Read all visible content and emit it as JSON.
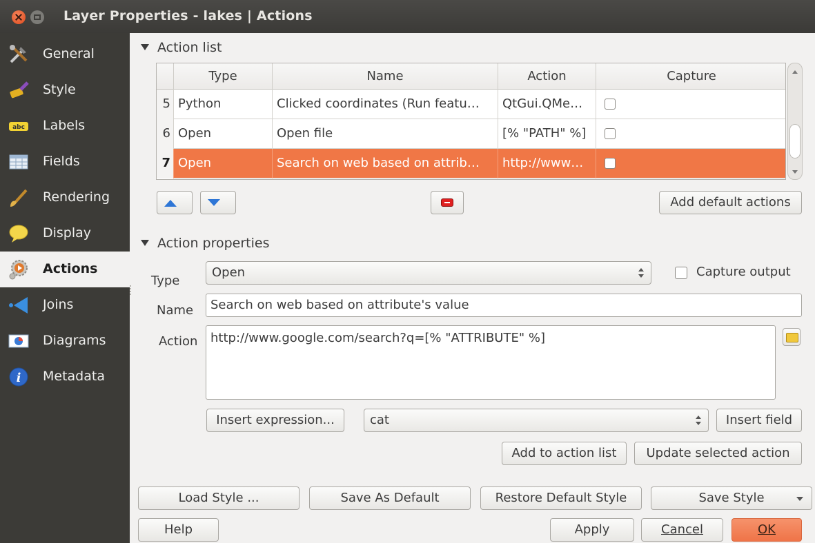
{
  "window": {
    "title": "Layer Properties - lakes | Actions"
  },
  "sidebar": {
    "items": [
      {
        "label": "General",
        "icon": "tools-icon",
        "active": false
      },
      {
        "label": "Style",
        "icon": "paintbrush-icon",
        "active": false
      },
      {
        "label": "Labels",
        "icon": "abc-label-icon",
        "active": false
      },
      {
        "label": "Fields",
        "icon": "table-icon",
        "active": false
      },
      {
        "label": "Rendering",
        "icon": "brush-icon",
        "active": false
      },
      {
        "label": "Display",
        "icon": "speech-bubble-icon",
        "active": false
      },
      {
        "label": "Actions",
        "icon": "gear-play-icon",
        "active": true
      },
      {
        "label": "Joins",
        "icon": "join-arrow-icon",
        "active": false
      },
      {
        "label": "Diagrams",
        "icon": "pie-diagram-icon",
        "active": false
      },
      {
        "label": "Metadata",
        "icon": "info-icon",
        "active": false
      }
    ]
  },
  "action_list": {
    "heading": "Action list",
    "columns": [
      "Type",
      "Name",
      "Action",
      "Capture"
    ],
    "rows": [
      {
        "num": "5",
        "type": "Python",
        "name": "Clicked coordinates (Run featu…",
        "action": "QtGui.QMe…",
        "capture": false,
        "selected": false
      },
      {
        "num": "6",
        "type": "Open",
        "name": "Open file",
        "action": "[% \"PATH\" %]",
        "capture": false,
        "selected": false
      },
      {
        "num": "7",
        "type": "Open",
        "name": "Search on web based on attrib…",
        "action": "http://www…",
        "capture": false,
        "selected": true
      }
    ],
    "add_default_label": "Add default actions"
  },
  "action_properties": {
    "heading": "Action properties",
    "type_label": "Type",
    "type_value": "Open",
    "capture_output_label": "Capture output",
    "name_label": "Name",
    "name_value": "Search on web based on attribute's value",
    "action_label": "Action",
    "action_value": "http://www.google.com/search?q=[% \"ATTRIBUTE\" %]",
    "insert_expression_label": "Insert expression...",
    "field_value": "cat",
    "insert_field_label": "Insert field",
    "add_to_list_label": "Add to action list",
    "update_selected_label": "Update selected action"
  },
  "footer": {
    "load_style": "Load Style ...",
    "save_as_default": "Save As Default",
    "restore_default": "Restore Default Style",
    "save_style": "Save Style",
    "help": "Help",
    "apply": "Apply",
    "cancel": "Cancel",
    "ok": "OK"
  },
  "colors": {
    "accent": "#f07746",
    "sidebar": "#3c3b37",
    "titlebar": "#3b3a37"
  }
}
